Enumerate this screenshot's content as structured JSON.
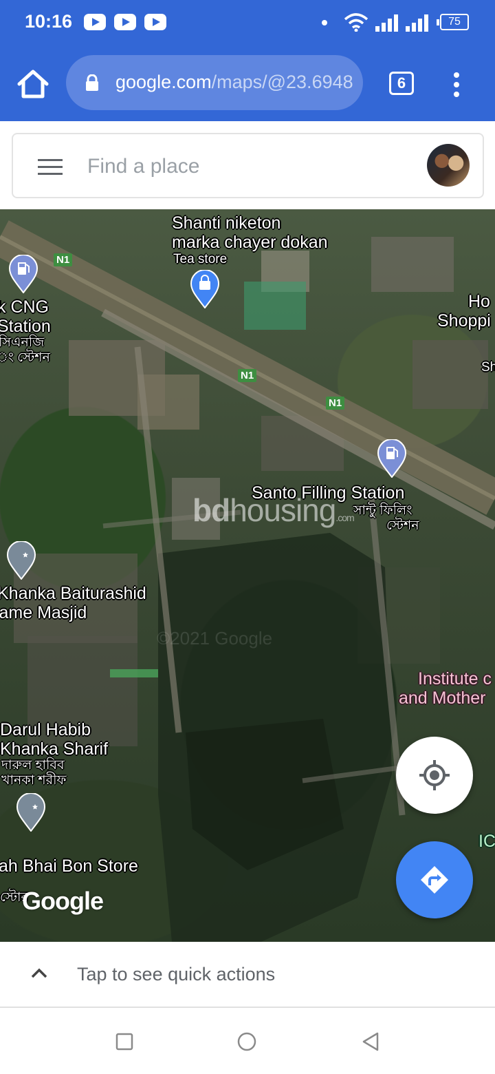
{
  "status_bar": {
    "time": "10:16",
    "battery": "75",
    "notification_icons": [
      "youtube-icon",
      "youtube-icon",
      "youtube-icon"
    ],
    "system_icons": [
      "wifi-icon",
      "signal-icon",
      "signal-icon",
      "battery-icon"
    ]
  },
  "browser": {
    "url_host": "google.com",
    "url_path": "/maps/@23.6948",
    "tab_count": "6"
  },
  "search": {
    "placeholder": "Find a place"
  },
  "map": {
    "labels": {
      "shanti_1": "Shanti niketon",
      "shanti_2": "marka chayer dokan",
      "shanti_cat": "Tea store",
      "cng_1": "k CNG",
      "cng_2": "Station",
      "cng_bn_1": "সিএনজি",
      "cng_bn_2": "ং স্টেশন",
      "hope_1": "Ho",
      "hope_2": "Shoppi",
      "sh": "Sh",
      "santo": "Santo Filling Station",
      "santo_bn_1": "সান্টু ফিলিং",
      "santo_bn_2": "স্টেশন",
      "khanka_1": "Khanka Baiturashid",
      "khanka_2": "Jame Masjid",
      "institute_1": "Institute c",
      "institute_2": "and Mother",
      "darul_1": "Darul Habib",
      "darul_2": "Khanka Sharif",
      "darul_bn_1": "দারুল হাবিব",
      "darul_bn_2": "খানকা শরীফ",
      "bhai_bon": "ah Bhai Bon Store",
      "bhai_bon_bn": "স্টোর",
      "ic": "IC"
    },
    "road_badges": [
      "N1",
      "N1",
      "N1"
    ],
    "watermark_bold": "bd",
    "watermark_rest": "housing",
    "watermark_com": ".com",
    "imagery_credit": "©2021 Google",
    "logo": "Google"
  },
  "bottom_sheet": {
    "label": "Tap to see quick actions"
  }
}
